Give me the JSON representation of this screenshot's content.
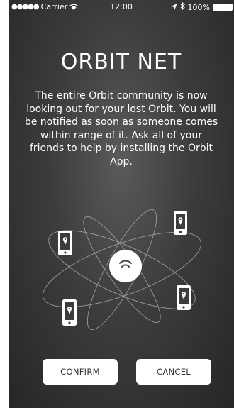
{
  "status_bar": {
    "signal_dots": "●●●●●",
    "carrier": "Carrier",
    "time": "12:00",
    "battery": "100%",
    "icons": [
      "wifi-icon",
      "location-arrow-icon",
      "bluetooth-icon",
      "battery-icon"
    ]
  },
  "screen": {
    "title": "ORBIT NET",
    "description": "The entire Orbit community is now looking out for your lost Orbit. You will be notified as soon as someone comes within range of it. Ask all of your friends to help by installing the Orbit App."
  },
  "illustration": {
    "icons": [
      "orbit-device-icon",
      "phone-location-icon"
    ]
  },
  "buttons": {
    "confirm": "CONFIRM",
    "cancel": "CANCEL"
  },
  "colors": {
    "background": "#3c3c3c",
    "text": "#ffffff",
    "button_bg": "#ffffff",
    "button_text": "#333333"
  }
}
